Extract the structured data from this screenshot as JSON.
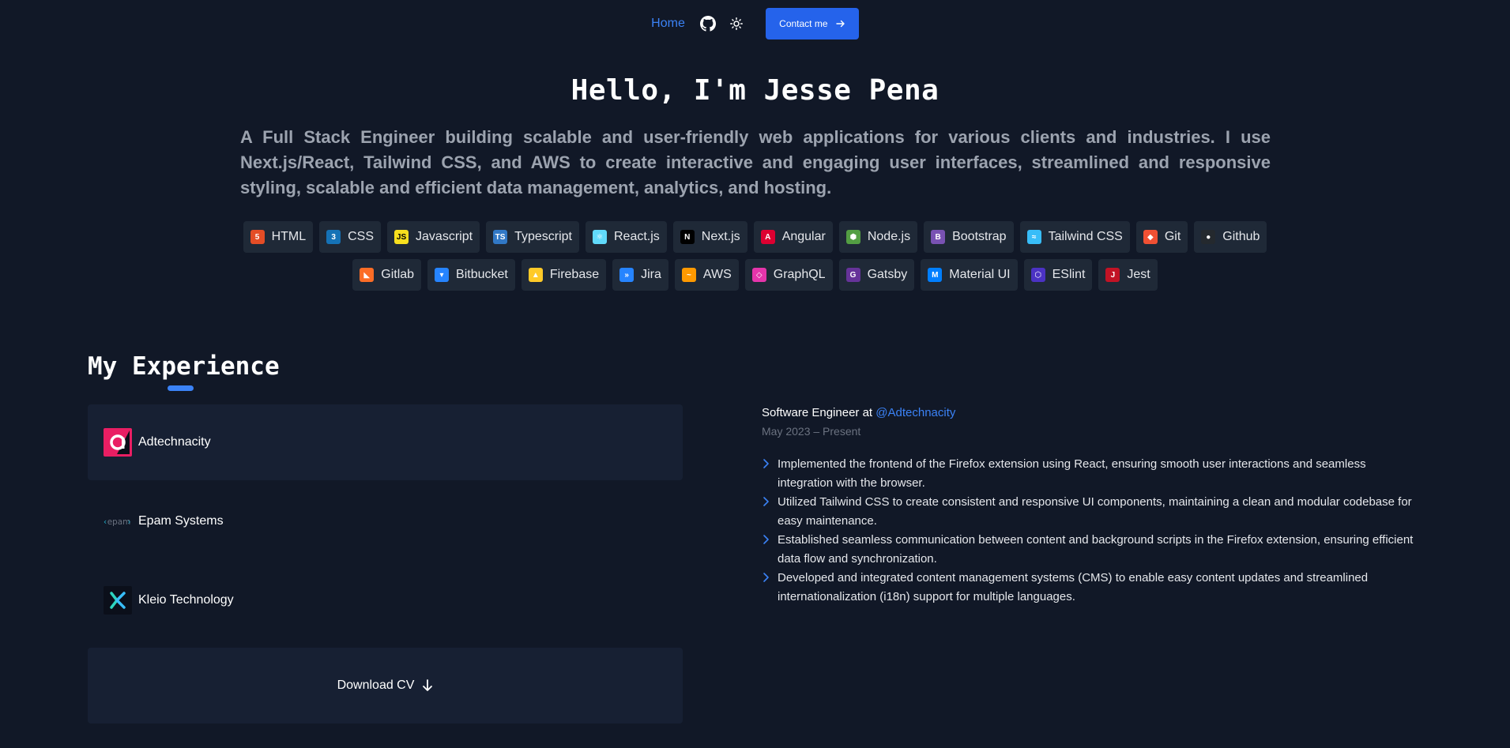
{
  "nav": {
    "home": "Home",
    "contact": "Contact me"
  },
  "hero": {
    "title": "Hello, I'm Jesse Pena",
    "description": "A Full Stack Engineer building scalable and user-friendly web applications for various clients and industries. I use Next.js/React, Tailwind CSS, and AWS to create interactive and engaging user interfaces, streamlined and responsive styling, scalable and efficient data management, analytics, and hosting."
  },
  "skills": {
    "row1": [
      {
        "label": "HTML",
        "icon": "html5-icon",
        "color": "#e44d26"
      },
      {
        "label": "CSS",
        "icon": "css3-icon",
        "color": "#1572b6"
      },
      {
        "label": "Javascript",
        "icon": "javascript-icon",
        "color": "#f7df1e"
      },
      {
        "label": "Typescript",
        "icon": "typescript-icon",
        "color": "#3178c6"
      },
      {
        "label": "React.js",
        "icon": "react-icon",
        "color": "#61dafb"
      },
      {
        "label": "Next.js",
        "icon": "nextjs-icon",
        "color": "#000000"
      },
      {
        "label": "Angular",
        "icon": "angular-icon",
        "color": "#dd0031"
      },
      {
        "label": "Node.js",
        "icon": "nodejs-icon",
        "color": "#539e43"
      },
      {
        "label": "Bootstrap",
        "icon": "bootstrap-icon",
        "color": "#7952b3"
      },
      {
        "label": "Tailwind CSS",
        "icon": "tailwind-icon",
        "color": "#38bdf8"
      },
      {
        "label": "Git",
        "icon": "git-icon",
        "color": "#f05033"
      },
      {
        "label": "Github",
        "icon": "github-icon",
        "color": "#24292e"
      }
    ],
    "row2": [
      {
        "label": "Gitlab",
        "icon": "gitlab-icon",
        "color": "#fc6d26"
      },
      {
        "label": "Bitbucket",
        "icon": "bitbucket-icon",
        "color": "#2684ff"
      },
      {
        "label": "Firebase",
        "icon": "firebase-icon",
        "color": "#ffca28"
      },
      {
        "label": "Jira",
        "icon": "jira-icon",
        "color": "#2684ff"
      },
      {
        "label": "AWS",
        "icon": "aws-icon",
        "color": "#ff9900"
      },
      {
        "label": "GraphQL",
        "icon": "graphql-icon",
        "color": "#e535ab"
      },
      {
        "label": "Gatsby",
        "icon": "gatsby-icon",
        "color": "#663399"
      },
      {
        "label": "Material UI",
        "icon": "materialui-icon",
        "color": "#007fff"
      },
      {
        "label": "ESlint",
        "icon": "eslint-icon",
        "color": "#4b32c3"
      },
      {
        "label": "Jest",
        "icon": "jest-icon",
        "color": "#c21325"
      }
    ]
  },
  "experience": {
    "title": "My Experience",
    "companies": [
      {
        "name": "Adtechnacity",
        "icon": "adtechnacity-logo"
      },
      {
        "name": "Epam Systems",
        "icon": "epam-logo"
      },
      {
        "name": "Kleio Technology",
        "icon": "kleio-logo"
      }
    ],
    "download": "Download CV",
    "detail": {
      "role": "Software Engineer at",
      "company": "@Adtechnacity",
      "dates": "May 2023 – Present",
      "bullets": [
        "Implemented the frontend of the Firefox extension using React, ensuring smooth user interactions and seamless integration with the browser.",
        "Utilized Tailwind CSS to create consistent and responsive UI components, maintaining a clean and modular codebase for easy maintenance.",
        "Established seamless communication between content and background scripts in the Firefox extension, ensuring efficient data flow and synchronization.",
        "Developed and integrated content management systems (CMS) to enable easy content updates and streamlined internationalization (i18n) support for multiple languages."
      ]
    }
  },
  "colors": {
    "background": "#111827",
    "accent": "#3b82f6",
    "card": "#1f2937"
  }
}
